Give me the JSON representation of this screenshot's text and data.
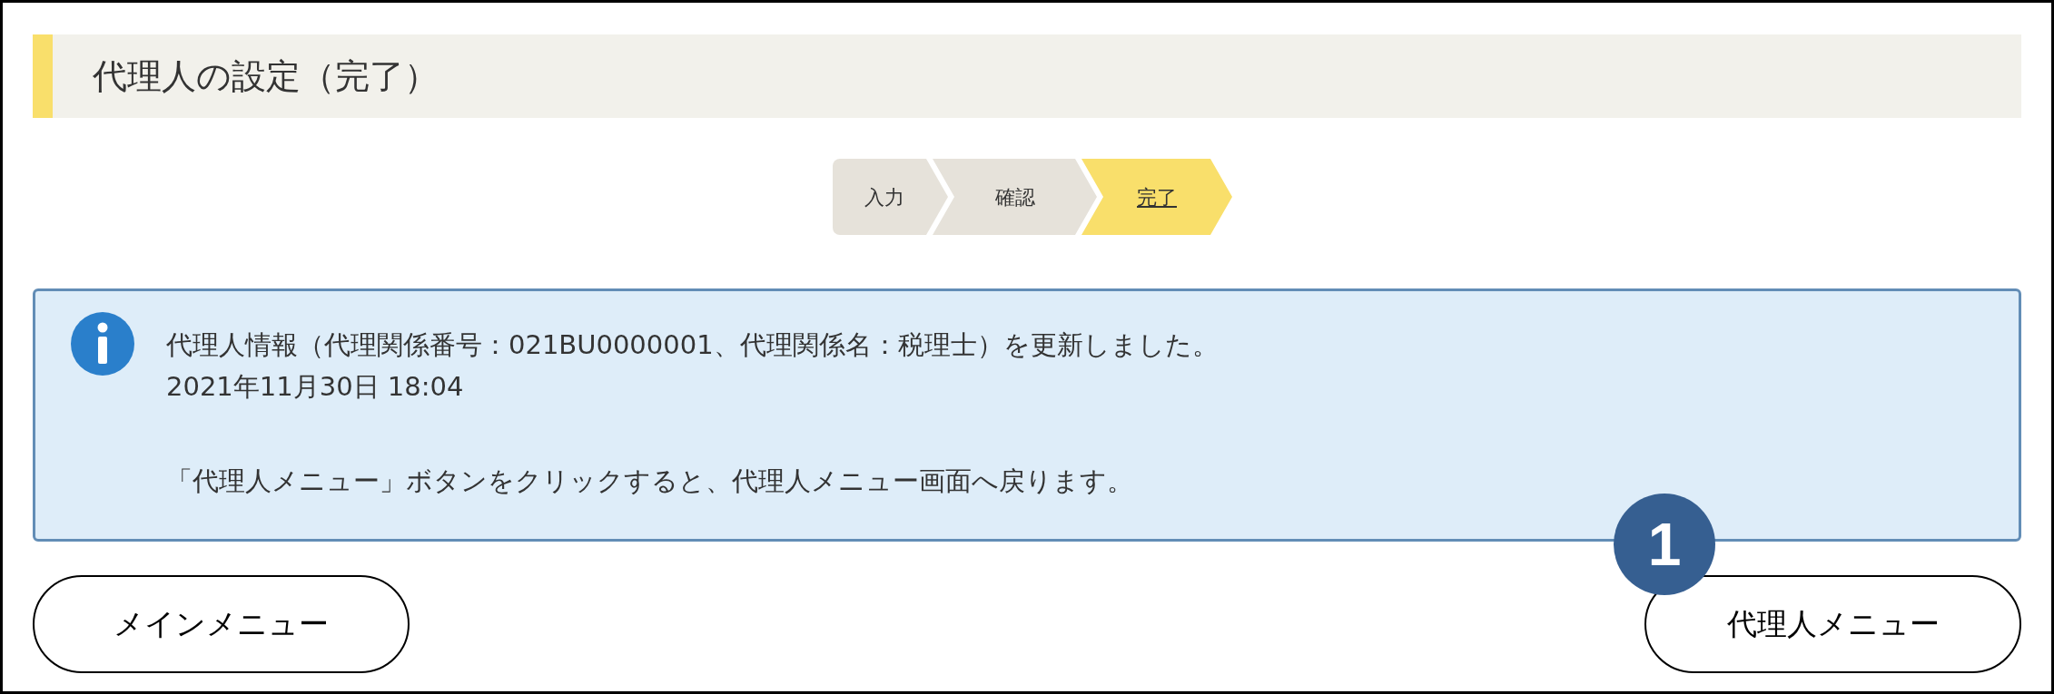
{
  "page_title": "代理人の設定（完了）",
  "steps": [
    {
      "label": "入力",
      "selected": false
    },
    {
      "label": "確認",
      "selected": false
    },
    {
      "label": "完了",
      "selected": true
    }
  ],
  "info": {
    "message": "代理人情報（代理関係番号：021BU0000001、代理関係名：税理士）を更新しました。",
    "timestamp": "2021年11月30日 18:04",
    "note": "「代理人メニュー」ボタンをクリックすると、代理人メニュー画面へ戻ります。"
  },
  "buttons": {
    "main_menu": "メインメニュー",
    "agent_menu": "代理人メニュー"
  },
  "callout_badge": "1"
}
